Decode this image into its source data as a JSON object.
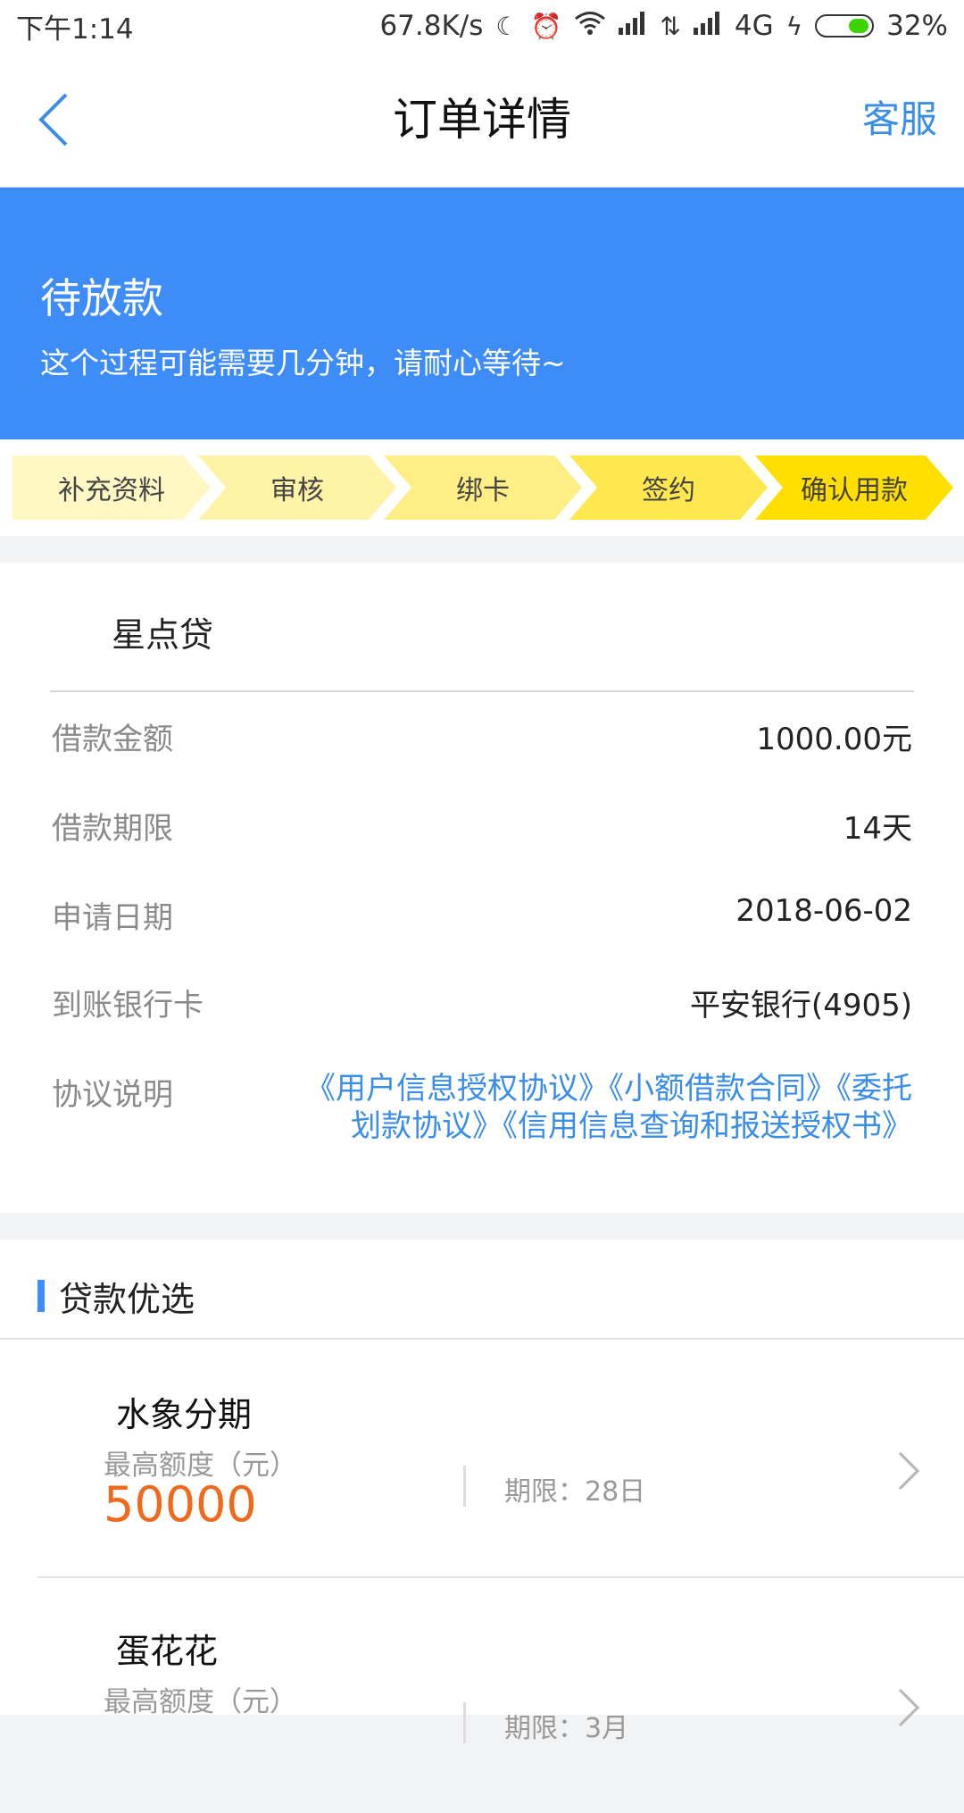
{
  "status_bar": {
    "time": "下午1:14",
    "net_speed": "67.8K/s",
    "network": "4G",
    "battery": "32%",
    "icons": [
      "moon-icon",
      "alarm-icon",
      "wifi-icon",
      "signal-icon",
      "data-arrows-icon",
      "signal-icon",
      "charging-icon",
      "battery-icon"
    ]
  },
  "nav": {
    "title": "订单详情",
    "service_label": "客服",
    "back_icon": "chevron-left-icon"
  },
  "status": {
    "title": "待放款",
    "description": "这个过程可能需要几分钟，请耐心等待~"
  },
  "steps": [
    {
      "label": "补充资料",
      "color": "#fff8c4"
    },
    {
      "label": "审核",
      "color": "#fff3a8"
    },
    {
      "label": "绑卡",
      "color": "#ffee86"
    },
    {
      "label": "签约",
      "color": "#ffe84f"
    },
    {
      "label": "确认用款",
      "color": "#ffde00"
    }
  ],
  "order": {
    "product_name": "星点贷",
    "rows": [
      {
        "label": "借款金额",
        "value": "1000.00元"
      },
      {
        "label": "借款期限",
        "value": "14天"
      },
      {
        "label": "申请日期",
        "value": "2018-06-02"
      },
      {
        "label": "到账银行卡",
        "value": "平安银行(4905)"
      }
    ],
    "agreement_label": "协议说明",
    "agreements": [
      "《用户信息授权协议》",
      "《小额借款合同》",
      "《委托划款协议》",
      "《信用信息查询和报送授权书》"
    ]
  },
  "recommend": {
    "title": "贷款优选",
    "items": [
      {
        "name": "水象分期",
        "limit_label": "最高额度（元）",
        "amount": "50000",
        "term": "期限：28日"
      },
      {
        "name": "蛋花花",
        "limit_label": "最高额度（元）",
        "amount": "",
        "term": "期限：3月"
      }
    ]
  },
  "colors": {
    "accent": "#3e8cf7",
    "link": "#3a8ee8",
    "amount": "#f06a1d"
  }
}
